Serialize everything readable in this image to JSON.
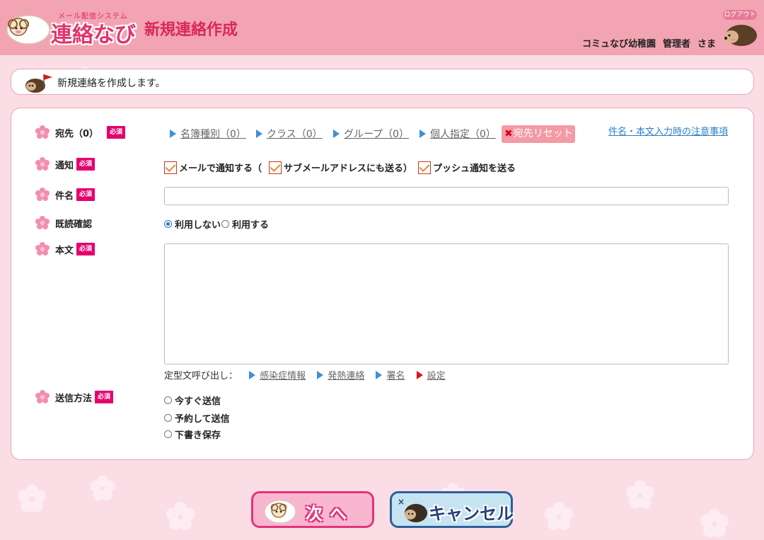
{
  "colors": {
    "header_bg": "#f2a4b2",
    "page_bg": "#fbdde6",
    "title": "#d8285c",
    "required_badge": "#e4006f",
    "link_blue": "#3f8fd6",
    "reset_button": "#f39aa5"
  },
  "header": {
    "logo_sub": "メール配信システム",
    "logo_main": "連絡なび",
    "title": "新規連絡作成",
    "org": "コミュなび幼稚園",
    "role": "管理者",
    "honorific": "さま",
    "logout": "ログアウト"
  },
  "message": {
    "text": "新規連絡を作成します。",
    "icon": "sheep-flag-icon"
  },
  "form": {
    "required_label": "必須",
    "destination": {
      "label": "宛先（0）",
      "links": [
        {
          "label": "名簿種別（0）"
        },
        {
          "label": "クラス（0）"
        },
        {
          "label": "グループ（0）"
        },
        {
          "label": "個人指定（0）"
        }
      ],
      "reset_label": "宛先リセット",
      "notice_link": "件名・本文入力時の注意事項"
    },
    "notify": {
      "label": "通知",
      "options": [
        {
          "label": "メールで通知する（",
          "checked": true
        },
        {
          "label": "サブメールアドレスにも送る）",
          "checked": true
        },
        {
          "label": "プッシュ通知を送る",
          "checked": true
        }
      ]
    },
    "subject": {
      "label": "件名",
      "value": ""
    },
    "read_confirm": {
      "label": "既読確認",
      "options": [
        {
          "label": "利用しない",
          "selected": true
        },
        {
          "label": "利用する",
          "selected": false
        }
      ]
    },
    "body": {
      "label": "本文",
      "value": "",
      "template_label": "定型文呼び出し：",
      "templates": [
        {
          "label": "感染症情報"
        },
        {
          "label": "発熱連絡"
        },
        {
          "label": "署名"
        },
        {
          "label": "設定"
        }
      ]
    },
    "send_method": {
      "label": "送信方法",
      "options": [
        {
          "label": "今すぐ送信",
          "selected": false
        },
        {
          "label": "予約して送信",
          "selected": false
        },
        {
          "label": "下書き保存",
          "selected": false
        }
      ]
    }
  },
  "buttons": {
    "next": "次へ",
    "cancel": "キャンセル"
  }
}
